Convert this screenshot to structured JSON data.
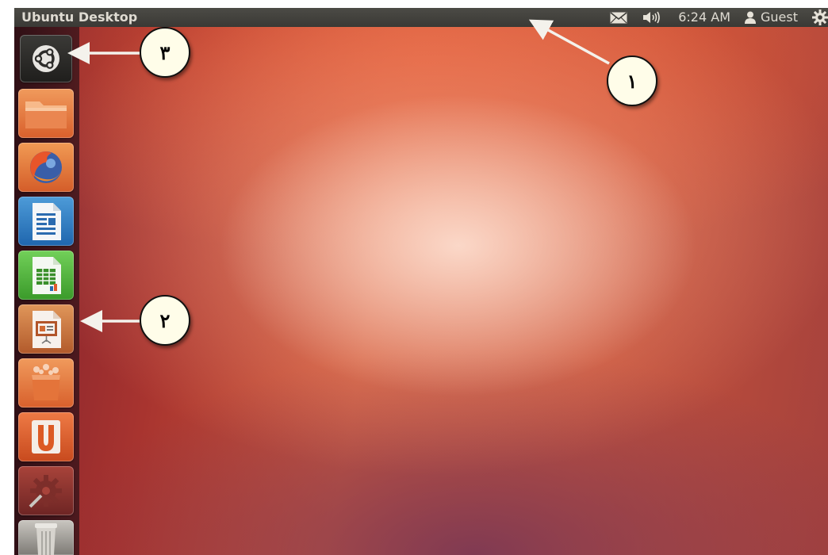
{
  "topbar": {
    "title": "Ubuntu Desktop",
    "clock": "6:24 AM",
    "user": "Guest",
    "icons": [
      "mail-icon",
      "volume-icon",
      "user-icon",
      "gear-icon"
    ]
  },
  "launcher": {
    "items": [
      {
        "name": "dash-home",
        "icon": "ubuntu-logo-icon"
      },
      {
        "name": "files",
        "icon": "folder-icon"
      },
      {
        "name": "firefox",
        "icon": "firefox-icon"
      },
      {
        "name": "writer",
        "icon": "writer-icon"
      },
      {
        "name": "calc",
        "icon": "calc-icon"
      },
      {
        "name": "impress",
        "icon": "impress-icon"
      },
      {
        "name": "software-center",
        "icon": "shopping-bag-icon"
      },
      {
        "name": "ubuntu-one",
        "icon": "ubuntu-one-icon"
      },
      {
        "name": "system-settings",
        "icon": "settings-icon"
      },
      {
        "name": "trash",
        "icon": "trash-icon"
      }
    ]
  },
  "annotations": {
    "callout_1": "١",
    "callout_2": "٢",
    "callout_3": "٣"
  },
  "colors": {
    "panel": "#3c3b37",
    "launcher": "#2b1016",
    "wallpaper_accent": "#dd5a3a"
  }
}
